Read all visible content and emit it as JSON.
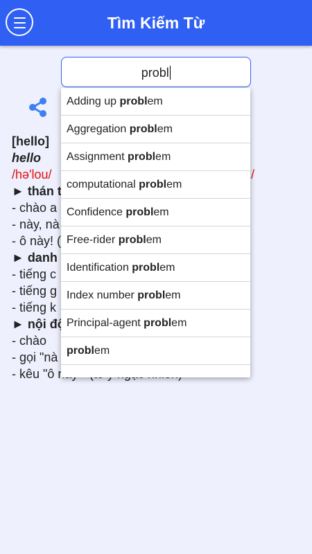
{
  "appbar": {
    "title": "Tìm Kiếm Từ",
    "menu_icon": "menu-icon"
  },
  "search": {
    "value": "probl"
  },
  "share_icon": "share-icon",
  "entry": {
    "headword_bracket": "[hello]",
    "headword": "hello",
    "ipa_start": "/hə'lou/",
    "ipa_end": "/",
    "lines": [
      {
        "type": "pos",
        "text": "► thán t"
      },
      {
        "type": "def",
        "text": "- chào a"
      },
      {
        "type": "def",
        "text": "- này, nà"
      },
      {
        "type": "def",
        "text": "- ô này! ("
      },
      {
        "type": "pos",
        "text": "► danh t"
      },
      {
        "type": "def",
        "text": "- tiếng c"
      },
      {
        "type": "def",
        "text": "- tiếng g"
      },
      {
        "type": "def",
        "text": "- tiếng k"
      },
      {
        "type": "pos",
        "text": "► nội độ"
      },
      {
        "type": "def",
        "text": "- chào"
      },
      {
        "type": "def",
        "text": "- gọi \"nà"
      },
      {
        "type": "def",
        "text": "- kêu \"ô này \" (tỏ ý ngạc nhiên)"
      }
    ]
  },
  "suggestions": [
    {
      "prefix": "Adding up ",
      "match": "probl",
      "suffix": "em"
    },
    {
      "prefix": "Aggregation ",
      "match": "probl",
      "suffix": "em"
    },
    {
      "prefix": "Assignment ",
      "match": "probl",
      "suffix": "em"
    },
    {
      "prefix": "computational ",
      "match": "probl",
      "suffix": "em"
    },
    {
      "prefix": "Confidence ",
      "match": "probl",
      "suffix": "em"
    },
    {
      "prefix": "Free-rider ",
      "match": "probl",
      "suffix": "em"
    },
    {
      "prefix": "Identification ",
      "match": "probl",
      "suffix": "em"
    },
    {
      "prefix": "Index number ",
      "match": "probl",
      "suffix": "em"
    },
    {
      "prefix": "Principal-agent ",
      "match": "probl",
      "suffix": "em"
    },
    {
      "prefix": "",
      "match": "probl",
      "suffix": "em"
    }
  ],
  "colors": {
    "accent": "#2f5ff3",
    "ipa": "#e01010",
    "background": "#eef0fd"
  }
}
